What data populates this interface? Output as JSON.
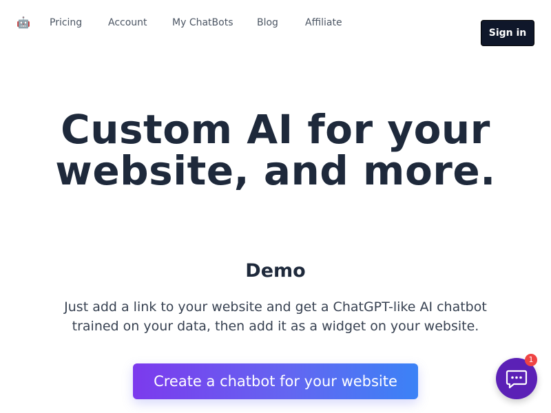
{
  "header": {
    "logo_icon": "robot-icon",
    "nav": [
      {
        "label": "Pricing"
      },
      {
        "label": "Account"
      },
      {
        "label": "My ChatBots"
      },
      {
        "label": "Blog"
      },
      {
        "label": "Affiliate"
      }
    ],
    "signin_label": "Sign in"
  },
  "hero": {
    "title_line1": "Custom AI for your",
    "title_line2": "website, and more."
  },
  "demo": {
    "title": "Demo",
    "description": "Just add a link to your website and get a ChatGPT-like AI chatbot trained on your data, then add it as a widget on your website.",
    "cta_label": "Create a chatbot for your website"
  },
  "chat_widget": {
    "icon": "chat-bubble-icon",
    "badge_count": "1"
  },
  "colors": {
    "signin_bg": "#0f172a",
    "cta_gradient_start": "#7c3aed",
    "cta_gradient_end": "#3b82f6",
    "chat_bubble": "#5b21b6",
    "badge": "#ef4444"
  }
}
